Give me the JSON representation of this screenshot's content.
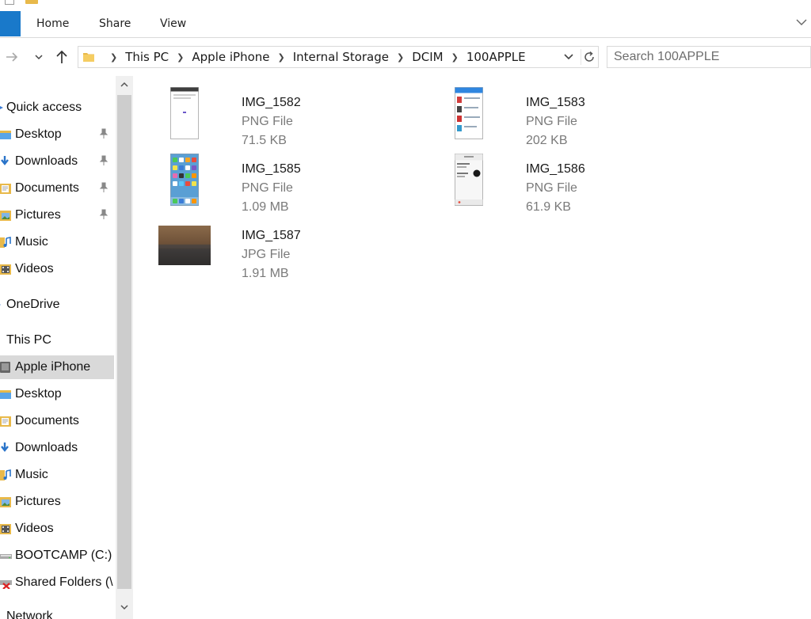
{
  "ribbon": {
    "tabs": [
      {
        "label": "Home"
      },
      {
        "label": "Share"
      },
      {
        "label": "View"
      }
    ]
  },
  "address": {
    "crumbs": [
      "This PC",
      "Apple iPhone",
      "Internal Storage",
      "DCIM",
      "100APPLE"
    ]
  },
  "search": {
    "placeholder": "Search 100APPLE"
  },
  "nav": {
    "quick_access": "Quick access",
    "quick_items": [
      "Desktop",
      "Downloads",
      "Documents",
      "Pictures",
      "Music",
      "Videos"
    ],
    "onedrive": "OneDrive",
    "this_pc": "This PC",
    "pc_items": [
      "Apple iPhone",
      "Desktop",
      "Documents",
      "Downloads",
      "Music",
      "Pictures",
      "Videos",
      "BOOTCAMP (C:)",
      "Shared Folders (\\",
      "Network"
    ]
  },
  "files": [
    {
      "name": "IMG_1582",
      "type": "PNG File",
      "size": "71.5 KB"
    },
    {
      "name": "IMG_1583",
      "type": "PNG File",
      "size": "202 KB"
    },
    {
      "name": "IMG_1585",
      "type": "PNG File",
      "size": "1.09 MB"
    },
    {
      "name": "IMG_1586",
      "type": "PNG File",
      "size": "61.9 KB"
    },
    {
      "name": "IMG_1587",
      "type": "JPG File",
      "size": "1.91 MB"
    }
  ],
  "colors": {
    "file_tab": "#1979ca",
    "selected_row": "#d9d9d9",
    "folder": "#e8b94a",
    "download_arrow": "#2a74c9",
    "secondary_text": "#7a7a7a"
  }
}
